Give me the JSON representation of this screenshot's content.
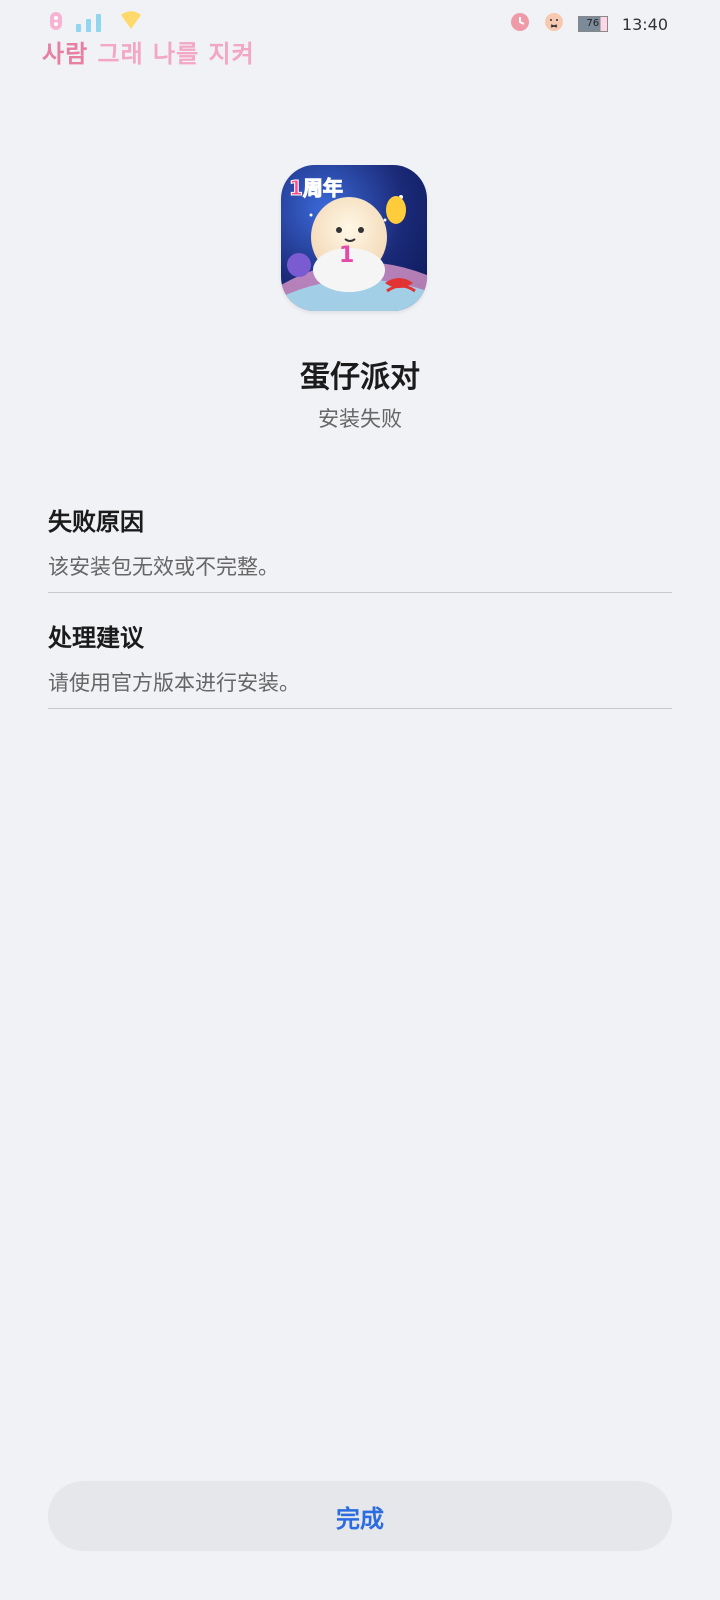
{
  "status_bar": {
    "lyric_first": "사람",
    "lyric_rest": "그래 나를 지켜",
    "time": "13:40",
    "battery": "76"
  },
  "app": {
    "name": "蛋仔派对",
    "status": "安装失败",
    "icon_badge": "1周年",
    "icon_number": "1"
  },
  "sections": [
    {
      "title": "失败原因",
      "desc": "该安装包无效或不完整。"
    },
    {
      "title": "处理建议",
      "desc": "请使用官方版本进行安装。"
    }
  ],
  "actions": {
    "done_label": "完成"
  },
  "colors": {
    "background": "#f1f2f6",
    "accent": "#2b6de0",
    "button_bg": "#e6e7ea",
    "lyric_pink": "#e77fa1"
  }
}
